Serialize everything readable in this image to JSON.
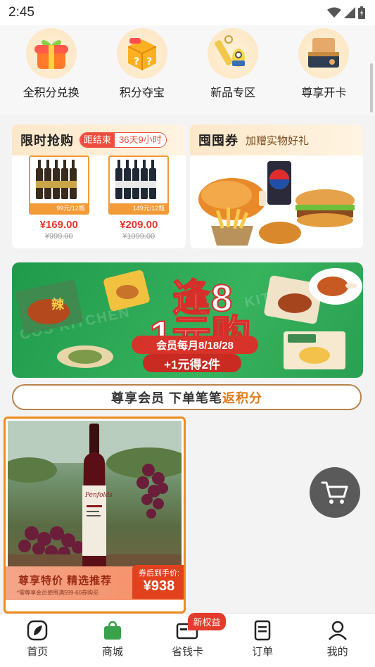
{
  "status_bar": {
    "time": "2:45"
  },
  "categories": [
    {
      "label": "全积分兑换",
      "icon": "gift-box-icon"
    },
    {
      "label": "积分夺宝",
      "icon": "mystery-box-icon"
    },
    {
      "label": "新品专区",
      "icon": "minion-keychain-icon"
    },
    {
      "label": "尊享开卡",
      "icon": "member-card-icon"
    }
  ],
  "flash_sale": {
    "title": "限时抢购",
    "countdown_label": "距结束",
    "countdown_value": "36天9小时",
    "products": [
      {
        "price": "¥169.00",
        "original_price": "¥999.00",
        "tag": "99元/12瓶"
      },
      {
        "price": "¥209.00",
        "original_price": "¥1099.00",
        "tag": "149元/12瓶"
      }
    ]
  },
  "coupon": {
    "title": "囤囤券",
    "subtitle": "加赠实物好礼"
  },
  "banner": {
    "line1": "逢8",
    "line2": "1元购",
    "pill": "会员每月8/18/28",
    "pill2": "+1元得2件"
  },
  "member_bar": {
    "text_a": "尊享会员 下单笔笔",
    "text_b": "返积分"
  },
  "feed": [
    {
      "tag": "尊享特价 精选推荐",
      "note": "*需尊享会员使用满599-60券购买",
      "price_label": "券后到手价:",
      "price": "¥938"
    }
  ],
  "tabs": [
    {
      "label": "首页",
      "icon": "home-icon"
    },
    {
      "label": "商城",
      "icon": "shopping-bag-icon"
    },
    {
      "label": "省钱卡",
      "icon": "card-icon",
      "badge": "新权益"
    },
    {
      "label": "订单",
      "icon": "order-list-icon"
    },
    {
      "label": "我的",
      "icon": "user-icon"
    }
  ],
  "colors": {
    "accent": "#ee4c3c",
    "brand_green": "#2aa052",
    "orange": "#f08a1d"
  }
}
